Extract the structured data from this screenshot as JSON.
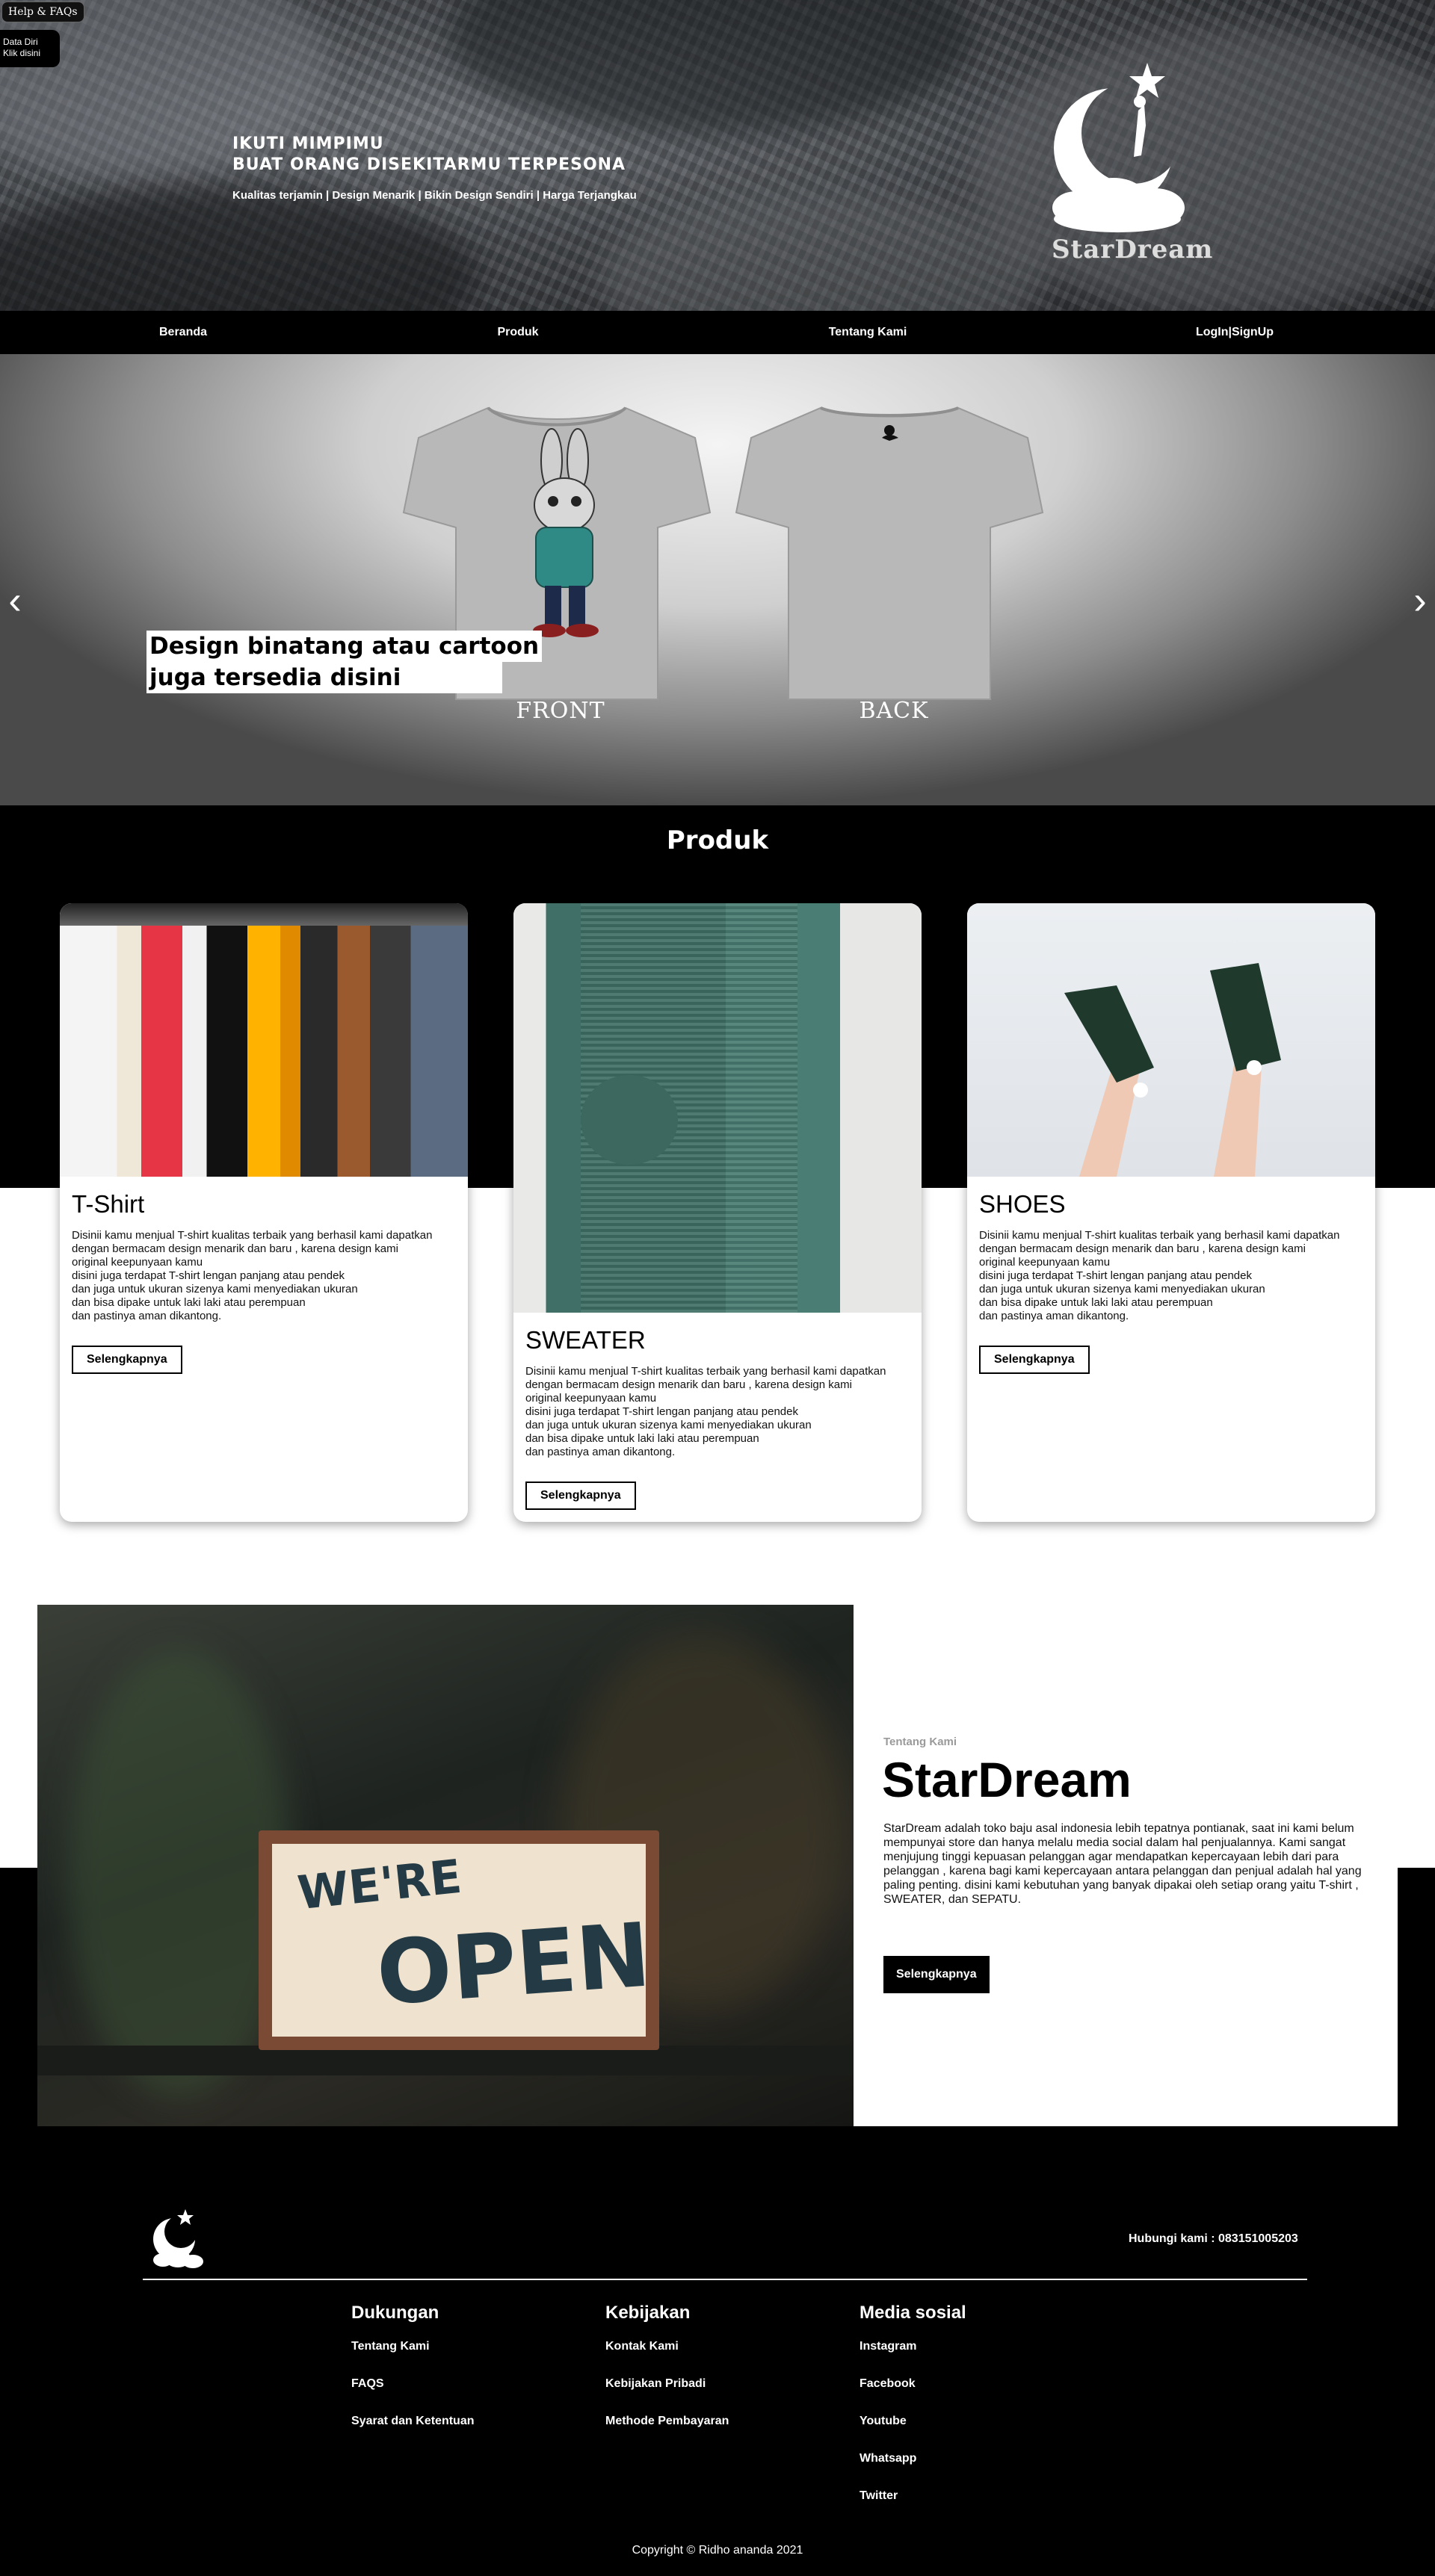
{
  "floating": {
    "help_label": "Help & FAQs",
    "data_line1": "Data Diri",
    "data_line2": "Klik disini"
  },
  "hero": {
    "headline1": "IKUTI MIMPIMU",
    "headline2": "BUAT ORANG DISEKITARMU TERPESONA",
    "tagline": "Kualitas terjamin | Design Menarik | Bikin Design Sendiri | Harga Terjangkau",
    "logo_text": "StarDream"
  },
  "nav": {
    "items": [
      "Beranda",
      "Produk",
      "Tentang Kami",
      "LogIn|SignUp"
    ]
  },
  "slider": {
    "caption_line1": "Design binatang atau cartoon",
    "caption_line2": "juga tersedia disini",
    "front_label": "FRONT",
    "back_label": "BACK",
    "prev_icon": "‹",
    "next_icon": "›"
  },
  "products": {
    "title": "Produk",
    "cards": [
      {
        "title": "T-Shirt",
        "desc": "Disinii kamu menjual T-shirt kualitas terbaik yang berhasil kami dapatkan\ndengan bermacam design menarik dan baru , karena design kami\noriginal keepunyaan kamu\ndisini juga terdapat T-shirt lengan panjang atau pendek\ndan juga untuk ukuran sizenya kami menyediakan ukuran\ndan bisa dipake untuk laki laki atau perempuan\ndan pastinya aman dikantong.",
        "button": "Selengkapnya"
      },
      {
        "title": "SWEATER",
        "desc": "Disinii kamu menjual T-shirt kualitas terbaik yang berhasil kami dapatkan\ndengan bermacam design menarik dan baru , karena design kami\noriginal keepunyaan kamu\ndisini juga terdapat T-shirt lengan panjang atau pendek\ndan juga untuk ukuran sizenya kami menyediakan ukuran\ndan bisa dipake untuk laki laki atau perempuan\ndan pastinya aman dikantong.",
        "button": "Selengkapnya"
      },
      {
        "title": "SHOES",
        "desc": "Disinii kamu menjual T-shirt kualitas terbaik yang berhasil kami dapatkan\ndengan bermacam design menarik dan baru , karena design kami\noriginal keepunyaan kamu\ndisini juga terdapat T-shirt lengan panjang atau pendek\ndan juga untuk ukuran sizenya kami menyediakan ukuran\ndan bisa dipake untuk laki laki atau perempuan\ndan pastinya aman dikantong.",
        "button": "Selengkapnya"
      }
    ]
  },
  "about": {
    "kicker": "Tentang Kami",
    "title": "StarDream",
    "text": "StarDream adalah toko baju asal indonesia lebih tepatnya pontianak, saat ini kami belum mempunyai store dan hanya melalu media social dalam hal penjualannya. Kami sangat menjujung tinggi kepuasan pelanggan agar mendapatkan kepercayaan lebih dari para pelanggan , karena bagi kami kepercayaan antara pelanggan dan penjual adalah hal yang paling penting. disini kami kebutuhan yang banyak dipakai oleh setiap orang yaitu T-shirt , SWEATER, dan SEPATU.",
    "button": "Selengkapnya",
    "sign_line1": "WE'RE",
    "sign_line2": "OPEN"
  },
  "footer": {
    "contact": "Hubungi kami : 083151005203",
    "columns": [
      {
        "heading": "Dukungan",
        "links": [
          "Tentang Kami",
          "FAQS",
          "Syarat dan Ketentuan"
        ]
      },
      {
        "heading": "Kebijakan",
        "links": [
          "Kontak Kami",
          "Kebijakan Pribadi",
          "Methode Pembayaran"
        ]
      },
      {
        "heading": "Media sosial",
        "links": [
          "Instagram",
          "Facebook",
          "Youtube",
          "Whatsapp",
          "Twitter"
        ]
      }
    ],
    "copyright": "Copyright © Ridho ananda 2021"
  }
}
